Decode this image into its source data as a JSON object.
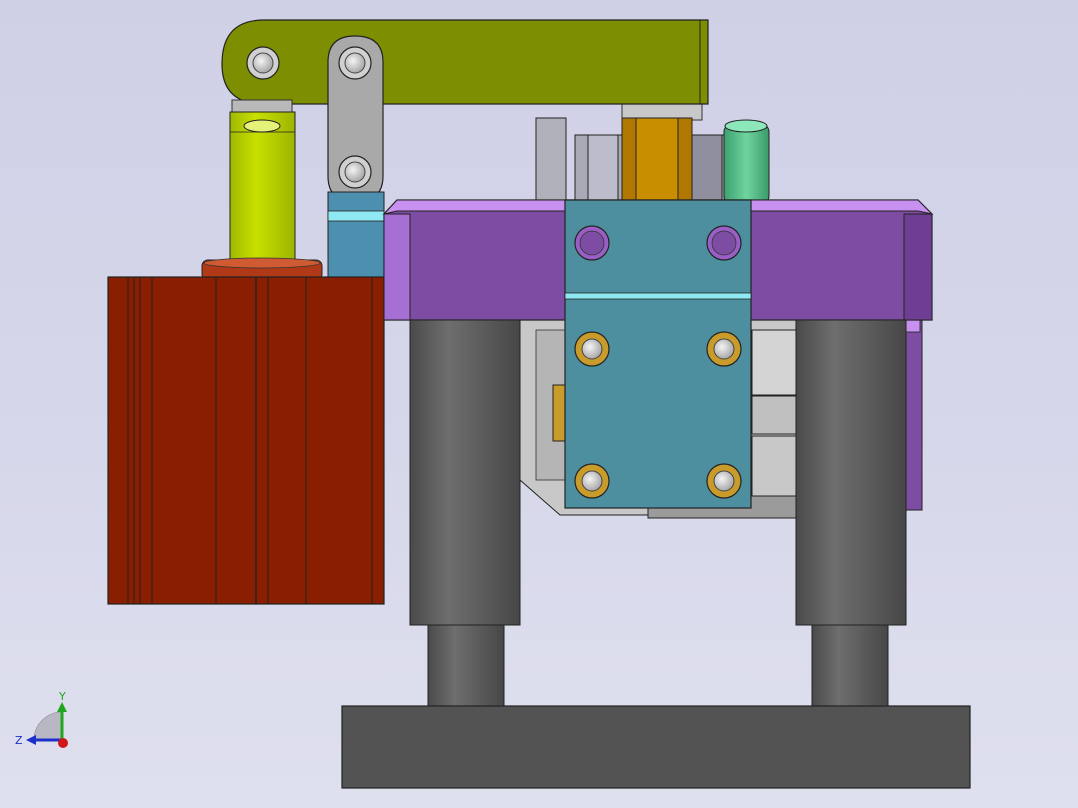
{
  "view": {
    "background_top": "#cfd0e6",
    "background_bottom": "#dfe0ee"
  },
  "triad": {
    "y_label": "Y",
    "z_label": "Z",
    "y_color": "#1fa61f",
    "z_color": "#1c2fc9",
    "x_color": "#d01616"
  },
  "colors": {
    "lever_arm": "#7d8f00",
    "link_plate": "#a9a9a9",
    "pin_column": "#b8d400",
    "cylinder_body": "#8a1e00",
    "cylinder_cap": "#b03a18",
    "support_plate": "#7d4da3",
    "support_plate_top": "#c890f0",
    "center_block": "#4d8f9e",
    "center_block_edge": "#8fe9f3",
    "guide_column": "#5b5b5b",
    "base_plate": "#535353",
    "hex_nut": "#b07800",
    "green_pin": "#4fb883",
    "grey_housing": "#a9a9b7",
    "brass_bushing": "#c89b2a"
  }
}
